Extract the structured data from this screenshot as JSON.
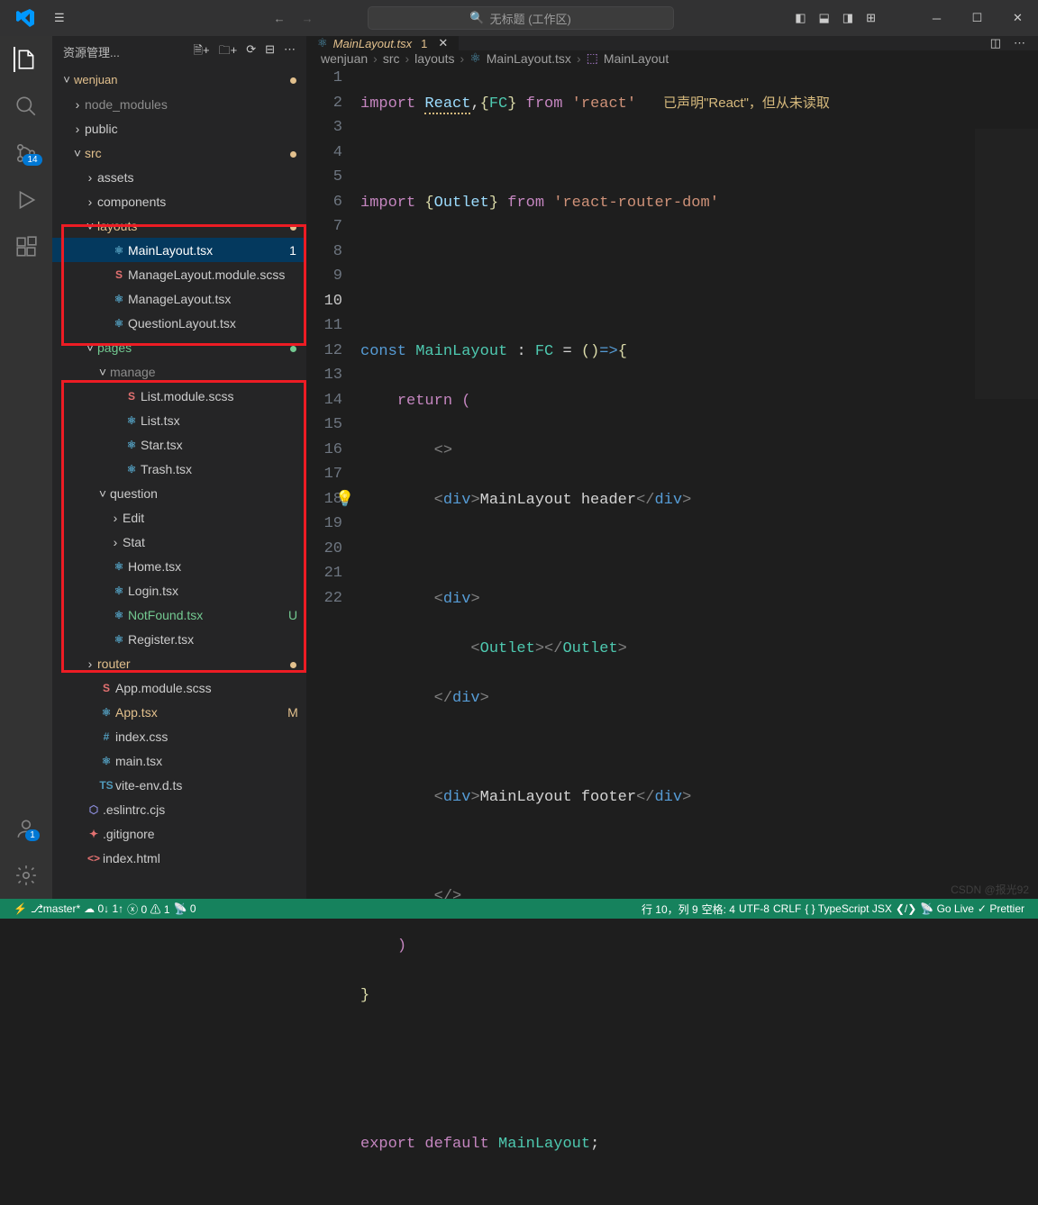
{
  "titlebar": {
    "search_placeholder": "无标题 (工作区)"
  },
  "sidebar": {
    "header": "资源管理...",
    "root": "wenjuan",
    "tree": [
      {
        "indent": 1,
        "chev": ">",
        "icon": "",
        "label": "node_modules",
        "cls": "mod-dim"
      },
      {
        "indent": 1,
        "chev": ">",
        "icon": "",
        "label": "public"
      },
      {
        "indent": 1,
        "chev": "v",
        "icon": "",
        "label": "src",
        "cls": "mod-orange",
        "status": "●"
      },
      {
        "indent": 2,
        "chev": ">",
        "icon": "",
        "label": "assets"
      },
      {
        "indent": 2,
        "chev": ">",
        "icon": "",
        "label": "components"
      },
      {
        "indent": 2,
        "chev": "v",
        "icon": "",
        "label": "layouts",
        "cls": "mod-orange",
        "status": "●"
      },
      {
        "indent": 3,
        "icon": "⚛",
        "label": "MainLayout.tsx",
        "selected": true,
        "status": "1",
        "statusCls": ""
      },
      {
        "indent": 3,
        "icon": "S",
        "iconColor": "#e37171",
        "label": "ManageLayout.module.scss"
      },
      {
        "indent": 3,
        "icon": "⚛",
        "label": "ManageLayout.tsx"
      },
      {
        "indent": 3,
        "icon": "⚛",
        "label": "QuestionLayout.tsx"
      },
      {
        "indent": 2,
        "chev": "v",
        "icon": "",
        "label": "pages",
        "cls": "mod-green",
        "status": "●",
        "statusColor": "#73c991"
      },
      {
        "indent": 3,
        "chev": "v",
        "icon": "",
        "label": "manage",
        "cls": "mod-dim"
      },
      {
        "indent": 4,
        "icon": "S",
        "iconColor": "#e37171",
        "label": "List.module.scss"
      },
      {
        "indent": 4,
        "icon": "⚛",
        "label": "List.tsx"
      },
      {
        "indent": 4,
        "icon": "⚛",
        "label": "Star.tsx"
      },
      {
        "indent": 4,
        "icon": "⚛",
        "label": "Trash.tsx"
      },
      {
        "indent": 3,
        "chev": "v",
        "icon": "",
        "label": "question"
      },
      {
        "indent": 4,
        "chev": ">",
        "icon": "",
        "label": "Edit"
      },
      {
        "indent": 4,
        "chev": ">",
        "icon": "",
        "label": "Stat"
      },
      {
        "indent": 3,
        "icon": "⚛",
        "label": "Home.tsx"
      },
      {
        "indent": 3,
        "icon": "⚛",
        "label": "Login.tsx"
      },
      {
        "indent": 3,
        "icon": "⚛",
        "label": "NotFound.tsx",
        "cls": "mod-green",
        "status": "U"
      },
      {
        "indent": 3,
        "icon": "⚛",
        "label": "Register.tsx"
      },
      {
        "indent": 2,
        "chev": ">",
        "icon": "",
        "label": "router",
        "cls": "mod-orange",
        "status": "●"
      },
      {
        "indent": 2,
        "icon": "S",
        "iconColor": "#e37171",
        "label": "App.module.scss"
      },
      {
        "indent": 2,
        "icon": "⚛",
        "label": "App.tsx",
        "cls": "mod-orange",
        "status": "M"
      },
      {
        "indent": 2,
        "icon": "#",
        "iconColor": "#519aba",
        "label": "index.css"
      },
      {
        "indent": 2,
        "icon": "⚛",
        "label": "main.tsx"
      },
      {
        "indent": 2,
        "icon": "TS",
        "iconColor": "#519aba",
        "label": "vite-env.d.ts"
      },
      {
        "indent": 1,
        "icon": "⬡",
        "iconColor": "#8889d4",
        "label": ".eslintrc.cjs"
      },
      {
        "indent": 1,
        "icon": "✦",
        "iconColor": "#e37171",
        "label": ".gitignore"
      },
      {
        "indent": 1,
        "icon": "<>",
        "iconColor": "#e37171",
        "label": "index.html"
      }
    ]
  },
  "activity": {
    "scm_badge": "14",
    "account_badge": "1"
  },
  "tab": {
    "name": "MainLayout.tsx",
    "num": "1"
  },
  "breadcrumb": [
    "wenjuan",
    "src",
    "layouts",
    "MainLayout.tsx",
    "MainLayout"
  ],
  "code": {
    "warning": "已声明\"React\"，但从未读取",
    "lines": 22
  },
  "statusbar": {
    "branch": "master*",
    "sync": "0↓ 1↑",
    "errors": "0",
    "warnings": "1",
    "port": "0",
    "position": "行 10，列 9",
    "spaces": "空格: 4",
    "encoding": "UTF-8",
    "eol": "CRLF",
    "lang": "TypeScript JSX",
    "golive": "Go Live",
    "prettier": "Prettier"
  },
  "watermark": "CSDN @报光92"
}
